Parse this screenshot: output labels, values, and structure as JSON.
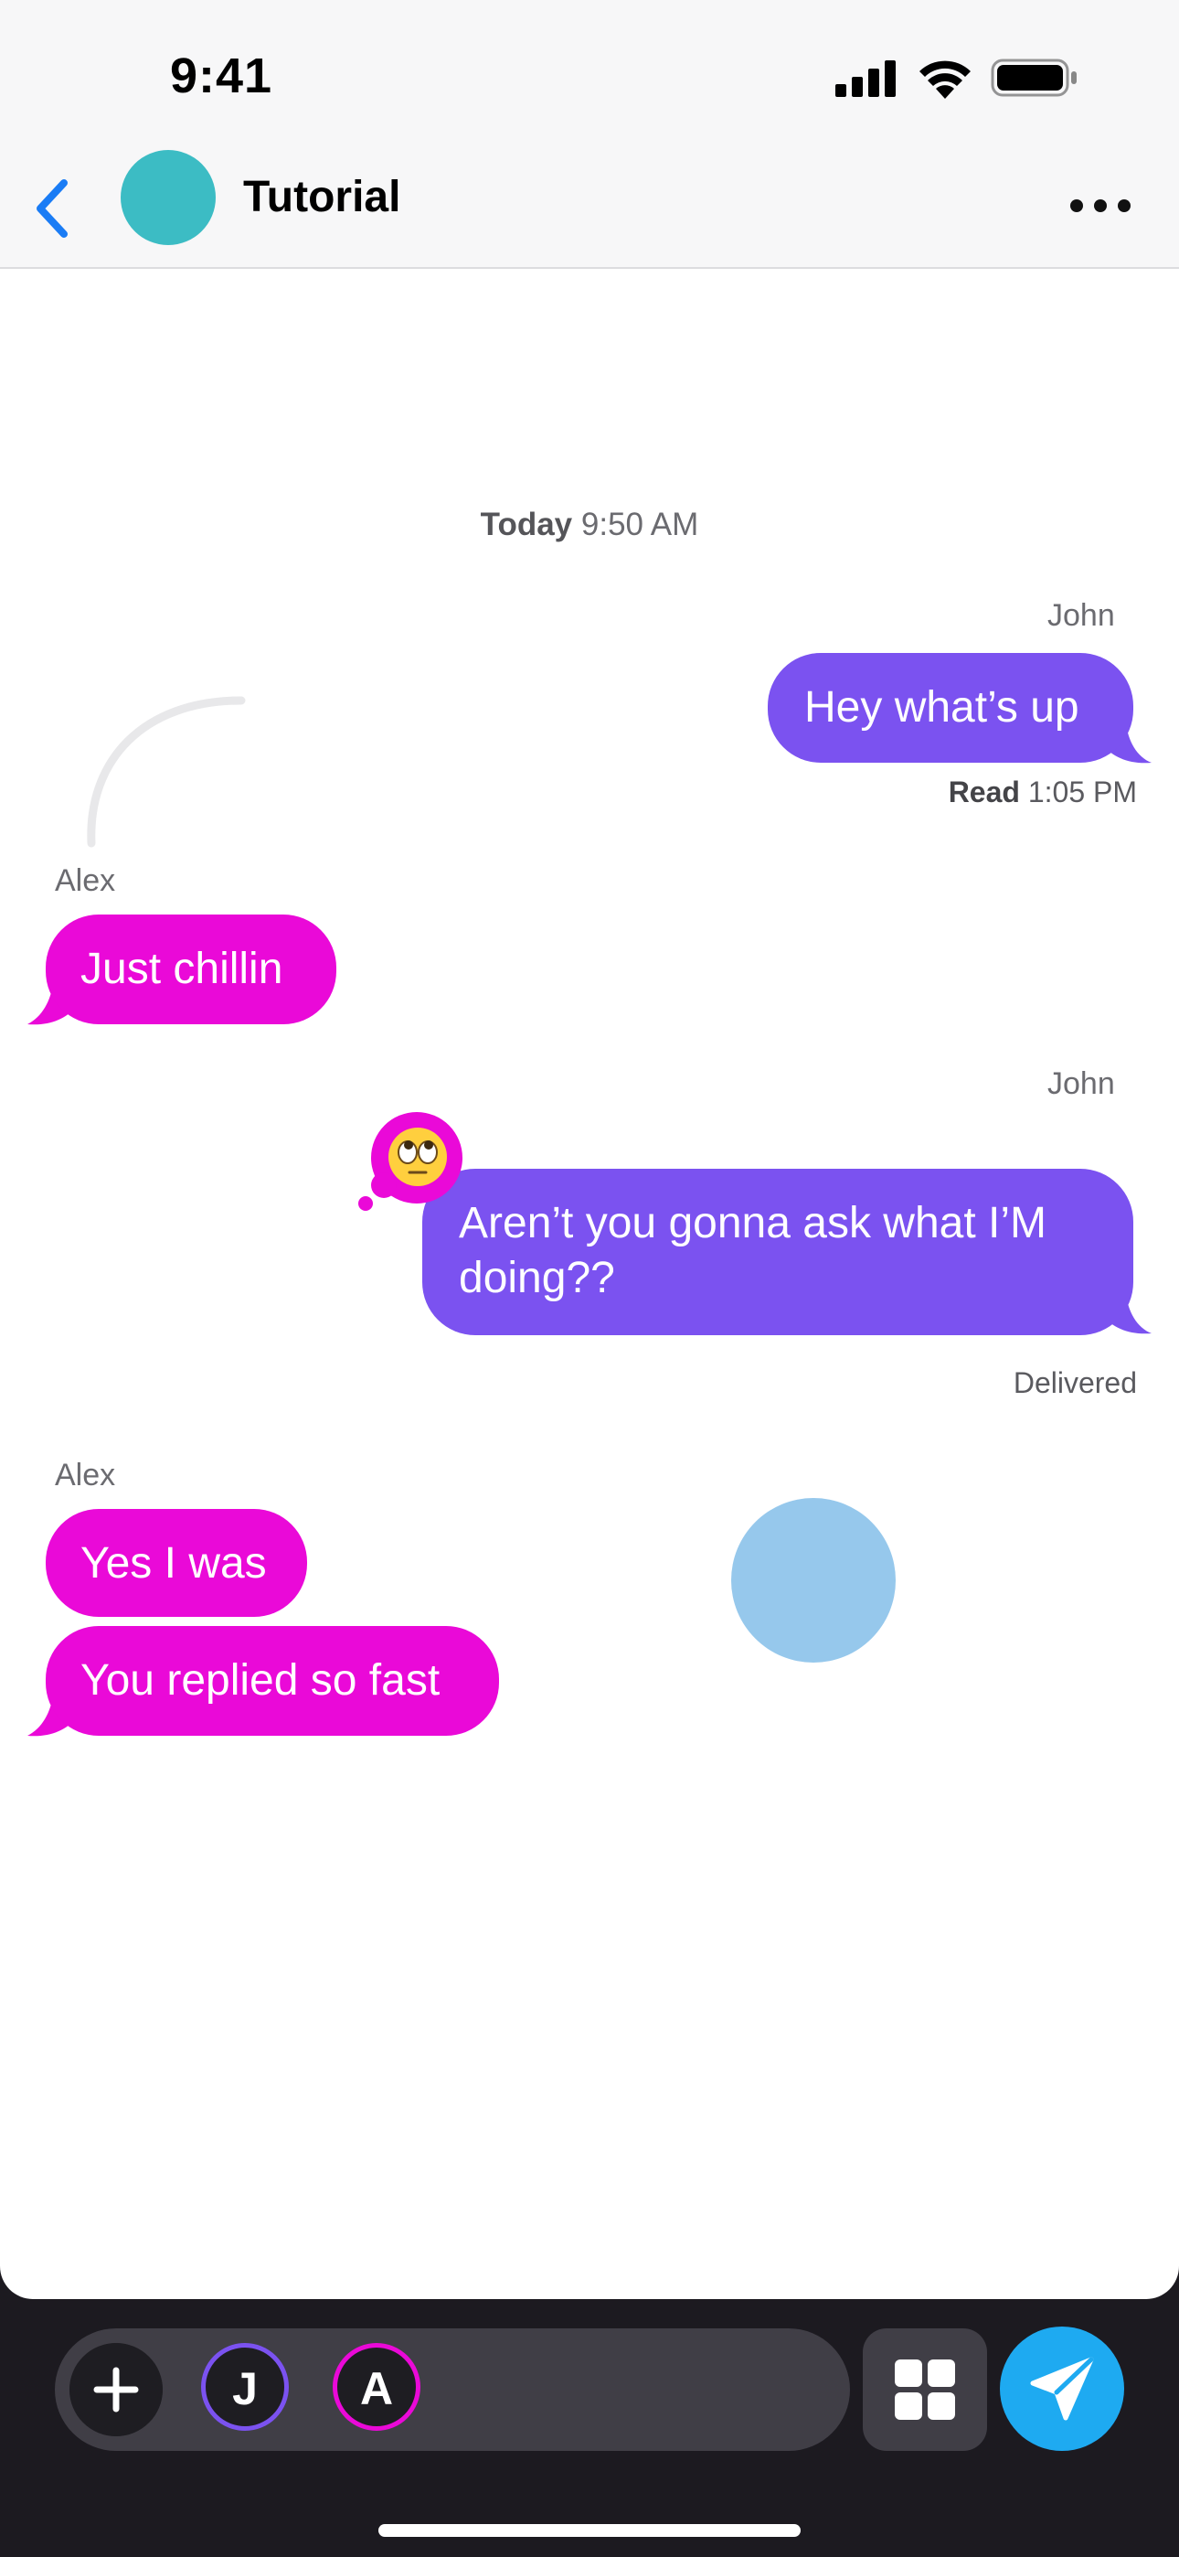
{
  "status_bar": {
    "time": "9:41"
  },
  "header": {
    "title": "Tutorial",
    "avatar_color": "#3cbcc4"
  },
  "conversation": {
    "timestamp_day": "Today",
    "timestamp_time": "9:50 AM",
    "messages": [
      {
        "sender": "John",
        "text": "Hey what’s up",
        "direction": "outgoing",
        "receipt_label": "Read",
        "receipt_time": "1:05 PM"
      },
      {
        "sender": "Alex",
        "text": "Just chillin",
        "direction": "incoming"
      },
      {
        "sender": "John",
        "text": "Aren’t you gonna ask what I’M doing??",
        "direction": "outgoing",
        "reaction": "face-with-rolling-eyes",
        "receipt_label": "Delivered"
      },
      {
        "sender": "Alex",
        "text": "Yes I was",
        "direction": "incoming"
      },
      {
        "sender": "Alex",
        "text": "You replied so fast",
        "direction": "incoming"
      }
    ]
  },
  "composer": {
    "participants": [
      {
        "initial": "J",
        "color": "#7b52f0"
      },
      {
        "initial": "A",
        "color": "#ea09d8"
      }
    ]
  },
  "colors": {
    "outgoing_bubble": "#7b52f0",
    "incoming_bubble": "#ea09d8",
    "send_button": "#1eaaf1",
    "accent_back": "#1a7cf5"
  }
}
